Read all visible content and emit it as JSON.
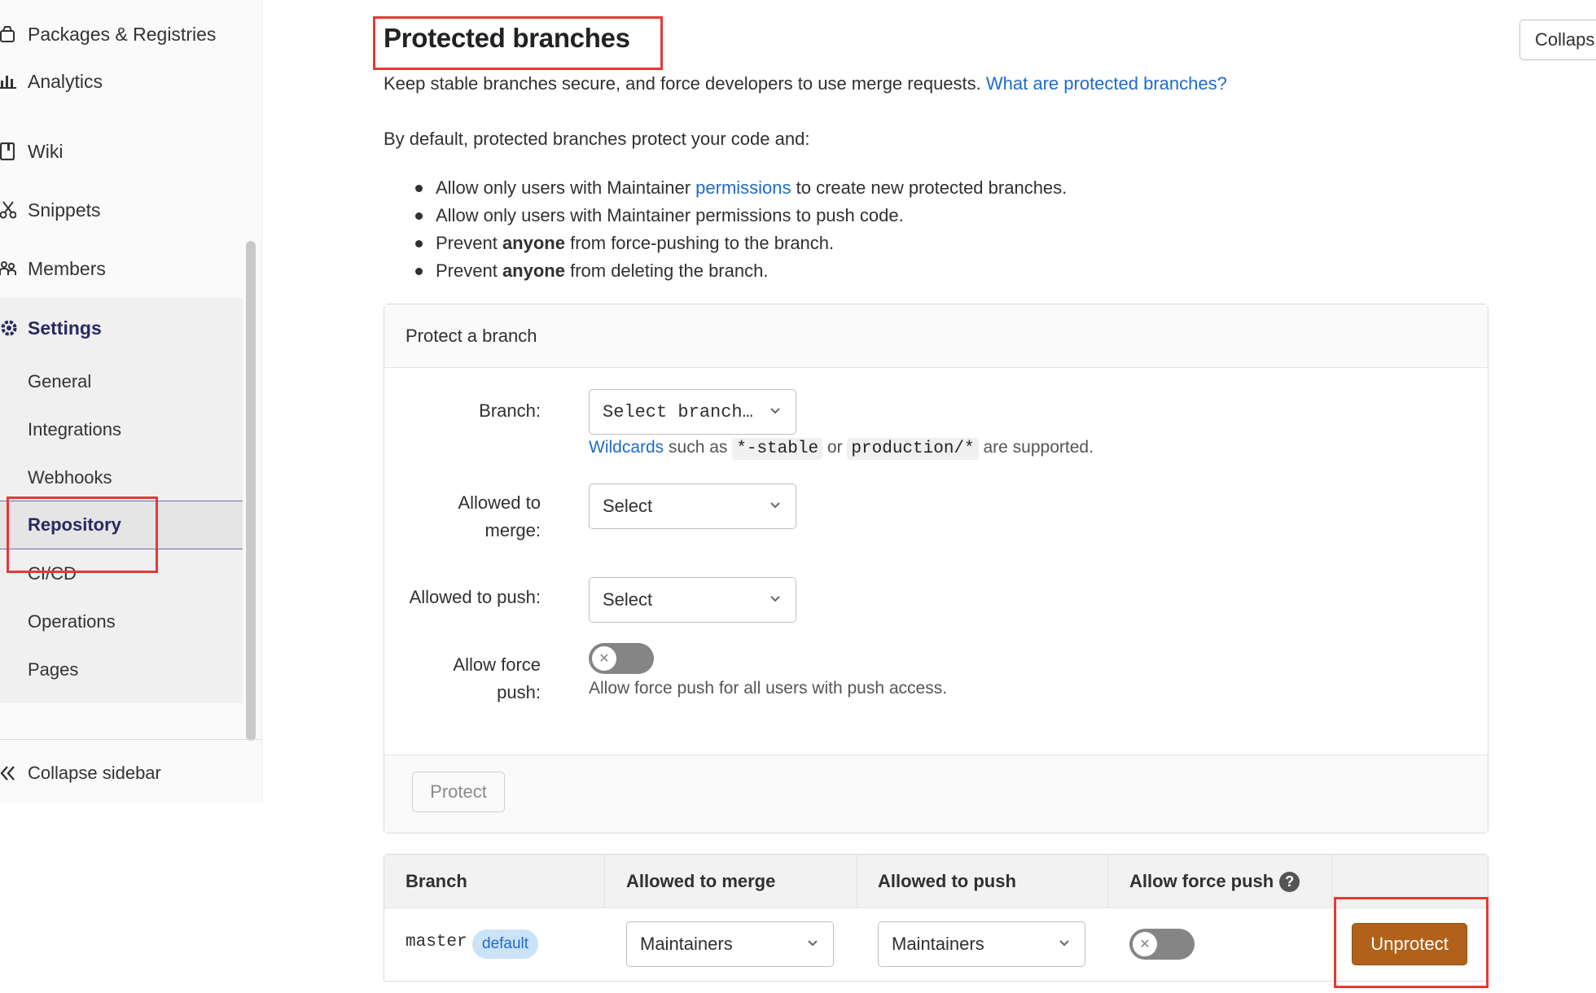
{
  "sidebar": {
    "items": [
      {
        "label": "Packages & Registries",
        "icon": "package-icon"
      },
      {
        "label": "Analytics",
        "icon": "chart-icon"
      },
      {
        "label": "Wiki",
        "icon": "book-icon"
      },
      {
        "label": "Snippets",
        "icon": "scissors-icon"
      },
      {
        "label": "Members",
        "icon": "users-icon"
      }
    ],
    "settings_label": "Settings",
    "settings_sub": [
      "General",
      "Integrations",
      "Webhooks",
      "Repository",
      "CI/CD",
      "Operations",
      "Pages"
    ],
    "active_item": "Repository",
    "collapse_label": "Collapse sidebar"
  },
  "main": {
    "title": "Protected branches",
    "collapse_button": "Collaps",
    "desc": "Keep stable branches secure, and force developers to use merge requests.",
    "desc_link": "What are protected branches?",
    "intro": "By default, protected branches protect your code and:",
    "rules": [
      {
        "pre": "Allow only users with Maintainer ",
        "link": "permissions",
        "post": " to create new protected branches."
      },
      {
        "pre": "Allow only users with Maintainer permissions to push code.",
        "link": "",
        "post": ""
      },
      {
        "pre": "Prevent ",
        "bold": "anyone",
        "post": " from force-pushing to the branch."
      },
      {
        "pre": "Prevent ",
        "bold": "anyone",
        "post": " from deleting the branch."
      }
    ]
  },
  "protect_form": {
    "header": "Protect a branch",
    "branch_label": "Branch:",
    "branch_placeholder": "Select branch…",
    "wildcards_link": "Wildcards",
    "wildcards_mid1": " such as ",
    "wildcard_ex1": "*-stable",
    "wildcards_mid2": " or ",
    "wildcard_ex2": "production/*",
    "wildcards_end": " are supported.",
    "merge_label_1": "Allowed to",
    "merge_label_2": "merge:",
    "merge_value": "Select",
    "push_label": "Allowed to push:",
    "push_value": "Select",
    "force_label_1": "Allow force",
    "force_label_2": "push:",
    "force_enabled": false,
    "force_hint": "Allow force push for all users with push access.",
    "protect_button": "Protect"
  },
  "table": {
    "headers": [
      "Branch",
      "Allowed to merge",
      "Allowed to push",
      "Allow force push"
    ],
    "rows": [
      {
        "branch": "master",
        "badge": "default",
        "merge": "Maintainers",
        "push": "Maintainers",
        "force": false,
        "action": "Unprotect"
      }
    ]
  },
  "colors": {
    "accent_link": "#1f6bc8",
    "nav_active": "#292961",
    "unprotect_button": "#b2611a",
    "highlight_box": "#e53935"
  }
}
